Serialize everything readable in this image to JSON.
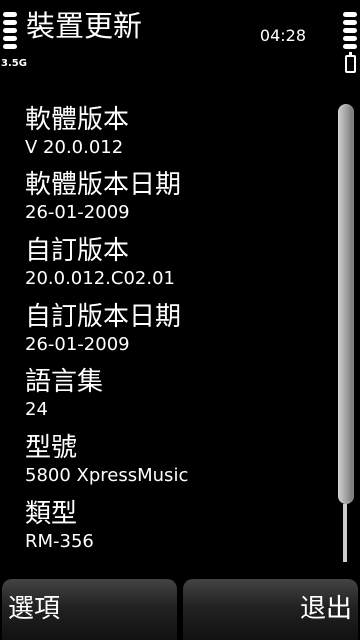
{
  "status": {
    "title": "裝置更新",
    "time": "04:28",
    "network": "3.5G",
    "signal_icon": "signal-strength-icon",
    "battery_icon": "battery-icon"
  },
  "details": [
    {
      "label": "軟體版本",
      "value": "V 20.0.012"
    },
    {
      "label": "軟體版本日期",
      "value": "26-01-2009"
    },
    {
      "label": "自訂版本",
      "value": "20.0.012.C02.01"
    },
    {
      "label": "自訂版本日期",
      "value": "26-01-2009"
    },
    {
      "label": "語言集",
      "value": "24"
    },
    {
      "label": "型號",
      "value": "5800 XpressMusic"
    },
    {
      "label": "類型",
      "value": "RM-356"
    }
  ],
  "softkeys": {
    "left": "選項",
    "right": "退出"
  }
}
